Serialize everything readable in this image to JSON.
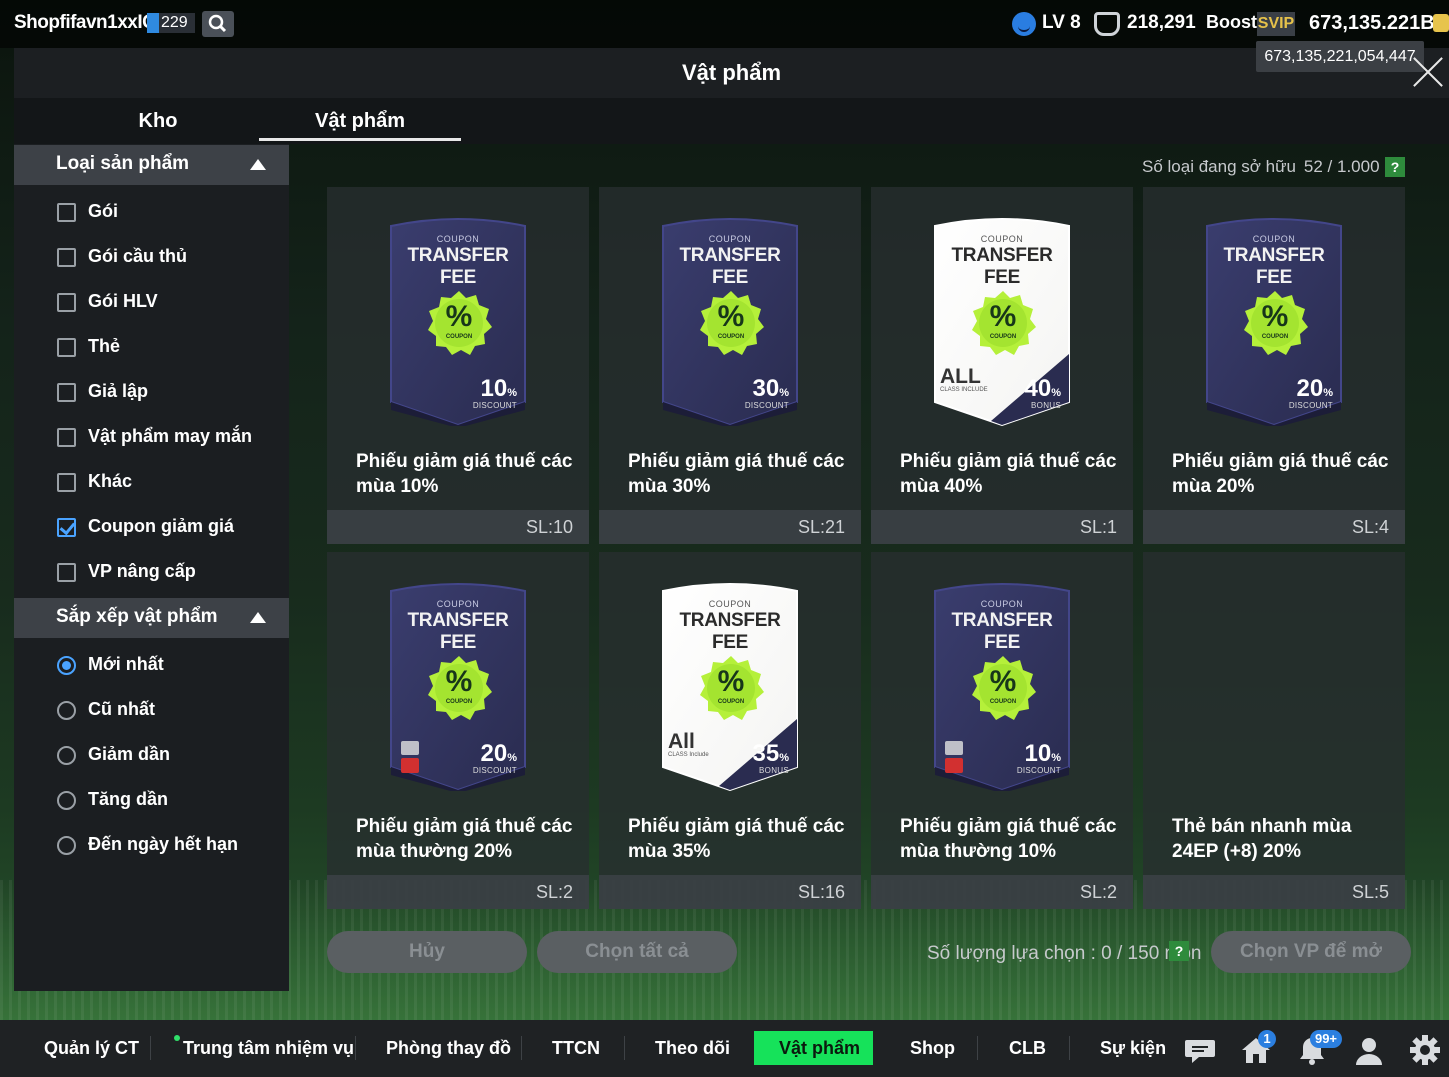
{
  "topbar": {
    "username": "Shopfifavn1xxIC",
    "user_level_badge": "229",
    "level": "LV 8",
    "trophies": "218,291",
    "boost_label": "Boost",
    "svip_label": "SVIP",
    "bp": "673,135.221B",
    "bp_tooltip": "673,135,221,054,447"
  },
  "header": {
    "title": "Vật phẩm"
  },
  "tabs": [
    {
      "label": "Kho",
      "active": false
    },
    {
      "label": "Vật phẩm",
      "active": true
    }
  ],
  "filters": {
    "type_heading": "Loại sản phẩm",
    "types": [
      {
        "label": "Gói",
        "checked": false
      },
      {
        "label": "Gói cầu thủ",
        "checked": false
      },
      {
        "label": "Gói HLV",
        "checked": false
      },
      {
        "label": "Thẻ",
        "checked": false
      },
      {
        "label": "Giả lập",
        "checked": false
      },
      {
        "label": "Vật phẩm may mắn",
        "checked": false
      },
      {
        "label": "Khác",
        "checked": false
      },
      {
        "label": "Coupon giảm giá",
        "checked": true
      },
      {
        "label": "VP nâng cấp",
        "checked": false
      }
    ],
    "sort_heading": "Sắp xếp vật phẩm",
    "sorts": [
      {
        "label": "Mới nhất",
        "selected": true
      },
      {
        "label": "Cũ nhất",
        "selected": false
      },
      {
        "label": "Giảm dần",
        "selected": false
      },
      {
        "label": "Tăng dần",
        "selected": false
      },
      {
        "label": "Đến ngày hết hạn",
        "selected": false
      }
    ]
  },
  "owned": {
    "label": "Số loại đang sở hữu",
    "value": "52 / 1.000 cái",
    "help": "?"
  },
  "items": [
    {
      "name": "Phiếu giảm giá thuế các mùa 10%",
      "qty": "SL:10",
      "card": {
        "top": "COUPON",
        "title": "TRANSFER FEE",
        "seal": "%",
        "seal_sub": "COUPON",
        "value": "10",
        "unit": "%",
        "value_label": "DISCOUNT",
        "style": "dark",
        "badge": ""
      }
    },
    {
      "name": "Phiếu giảm giá thuế các mùa 30%",
      "qty": "SL:21",
      "card": {
        "top": "COUPON",
        "title": "TRANSFER FEE",
        "seal": "%",
        "seal_sub": "COUPON",
        "value": "30",
        "unit": "%",
        "value_label": "DISCOUNT",
        "style": "dark",
        "badge": ""
      }
    },
    {
      "name": "Phiếu giảm giá thuế các mùa 40%",
      "qty": "SL:1",
      "card": {
        "top": "COUPON",
        "title": "TRANSFER FEE",
        "seal": "%",
        "seal_sub": "COUPON",
        "value": "40",
        "unit": "%",
        "value_label": "BONUS",
        "style": "white",
        "badge": "ALL",
        "badge_sub": "CLASS INCLUDE"
      }
    },
    {
      "name": "Phiếu giảm giá thuế các mùa 20%",
      "qty": "SL:4",
      "card": {
        "top": "COUPON",
        "title": "TRANSFER FEE",
        "seal": "%",
        "seal_sub": "COUPON",
        "value": "20",
        "unit": "%",
        "value_label": "DISCOUNT",
        "style": "dark",
        "badge": ""
      }
    },
    {
      "name": "Phiếu giảm giá thuế các mùa thường 20%",
      "qty": "SL:2",
      "card": {
        "top": "COUPON",
        "title": "TRANSFER FEE",
        "seal": "%",
        "seal_sub": "COUPON",
        "value": "20",
        "unit": "%",
        "value_label": "DISCOUNT",
        "style": "dark",
        "badge": "no-icon"
      }
    },
    {
      "name": "Phiếu giảm giá thuế các mùa 35%",
      "qty": "SL:16",
      "card": {
        "top": "COUPON",
        "title": "TRANSFER FEE",
        "seal": "%",
        "seal_sub": "COUPON",
        "value": "35",
        "unit": "%",
        "value_label": "BONUS",
        "style": "white",
        "badge": "All",
        "badge_sub": "CLASS Include"
      }
    },
    {
      "name": "Phiếu giảm giá thuế các mùa thường 10%",
      "qty": "SL:2",
      "card": {
        "top": "COUPON",
        "title": "TRANSFER FEE",
        "seal": "%",
        "seal_sub": "COUPON",
        "value": "10",
        "unit": "%",
        "value_label": "DISCOUNT",
        "style": "dark",
        "badge": "no-icon"
      }
    },
    {
      "name": "Thẻ bán nhanh mùa 24EP (+8) 20%",
      "qty": "SL:5",
      "card": null
    }
  ],
  "footer": {
    "cancel": "Hủy",
    "select_all": "Chọn tất cả",
    "selection_label": "Số lượng lựa chọn : 0 / 150 món",
    "help": "?",
    "open": "Chọn VP để mở"
  },
  "nav": {
    "items": [
      "Quản lý CT",
      "Trung tâm nhiệm vụ",
      "Phòng thay đồ",
      "TTCN",
      "Theo dõi",
      "Vật phẩm",
      "Shop",
      "CLB",
      "Sự kiện"
    ],
    "active": "Vật phẩm",
    "home_badge": "1",
    "bell_badge": "99+",
    "icons": [
      "chat-icon",
      "home-icon",
      "bell-icon",
      "profile-icon",
      "gear-icon"
    ]
  }
}
